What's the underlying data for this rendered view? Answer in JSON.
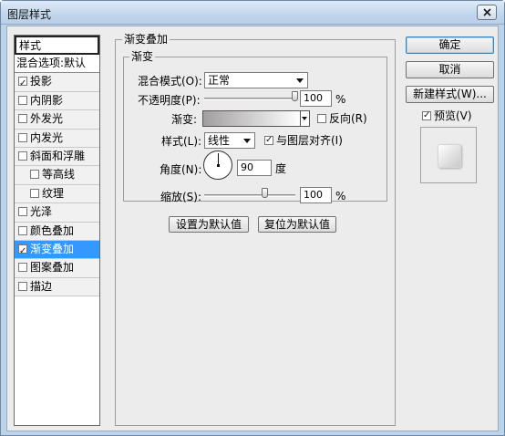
{
  "window": {
    "title": "图层样式"
  },
  "style_list": {
    "header": "样式",
    "items": [
      {
        "label": "混合选项:默认",
        "has_checkbox": false,
        "checked": false,
        "indent": false,
        "selected": false
      },
      {
        "label": "投影",
        "has_checkbox": true,
        "checked": true,
        "indent": false,
        "selected": false
      },
      {
        "label": "内阴影",
        "has_checkbox": true,
        "checked": false,
        "indent": false,
        "selected": false
      },
      {
        "label": "外发光",
        "has_checkbox": true,
        "checked": false,
        "indent": false,
        "selected": false
      },
      {
        "label": "内发光",
        "has_checkbox": true,
        "checked": false,
        "indent": false,
        "selected": false
      },
      {
        "label": "斜面和浮雕",
        "has_checkbox": true,
        "checked": false,
        "indent": false,
        "selected": false
      },
      {
        "label": "等高线",
        "has_checkbox": true,
        "checked": false,
        "indent": true,
        "selected": false
      },
      {
        "label": "纹理",
        "has_checkbox": true,
        "checked": false,
        "indent": true,
        "selected": false
      },
      {
        "label": "光泽",
        "has_checkbox": true,
        "checked": false,
        "indent": false,
        "selected": false
      },
      {
        "label": "颜色叠加",
        "has_checkbox": true,
        "checked": false,
        "indent": false,
        "selected": false
      },
      {
        "label": "渐变叠加",
        "has_checkbox": true,
        "checked": true,
        "indent": false,
        "selected": true
      },
      {
        "label": "图案叠加",
        "has_checkbox": true,
        "checked": false,
        "indent": false,
        "selected": false
      },
      {
        "label": "描边",
        "has_checkbox": true,
        "checked": false,
        "indent": false,
        "selected": false
      }
    ]
  },
  "gradient_overlay": {
    "group_title": "渐变叠加",
    "sub_title": "渐变",
    "blend_mode_label": "混合模式(O):",
    "blend_mode_value": "正常",
    "opacity_label": "不透明度(P):",
    "opacity_value": "100",
    "opacity_level": 100,
    "opacity_unit": "%",
    "gradient_label": "渐变:",
    "gradient_colors": [
      "#a19e9f",
      "#ffffff"
    ],
    "reverse_label": "反向(R)",
    "reverse_checked": false,
    "style_label": "样式(L):",
    "style_value": "线性",
    "align_label": "与图层对齐(I)",
    "align_checked": true,
    "angle_label": "角度(N):",
    "angle_value": "90",
    "angle_unit": "度",
    "scale_label": "缩放(S):",
    "scale_value": "100",
    "scale_level": 100,
    "scale_unit": "%",
    "make_default_label": "设置为默认值",
    "reset_default_label": "复位为默认值"
  },
  "buttons": {
    "ok": "确定",
    "cancel": "取消",
    "new_style": "新建样式(W)...",
    "preview_label": "预览(V)",
    "preview_checked": true
  },
  "icons": {
    "close": "close-icon"
  }
}
